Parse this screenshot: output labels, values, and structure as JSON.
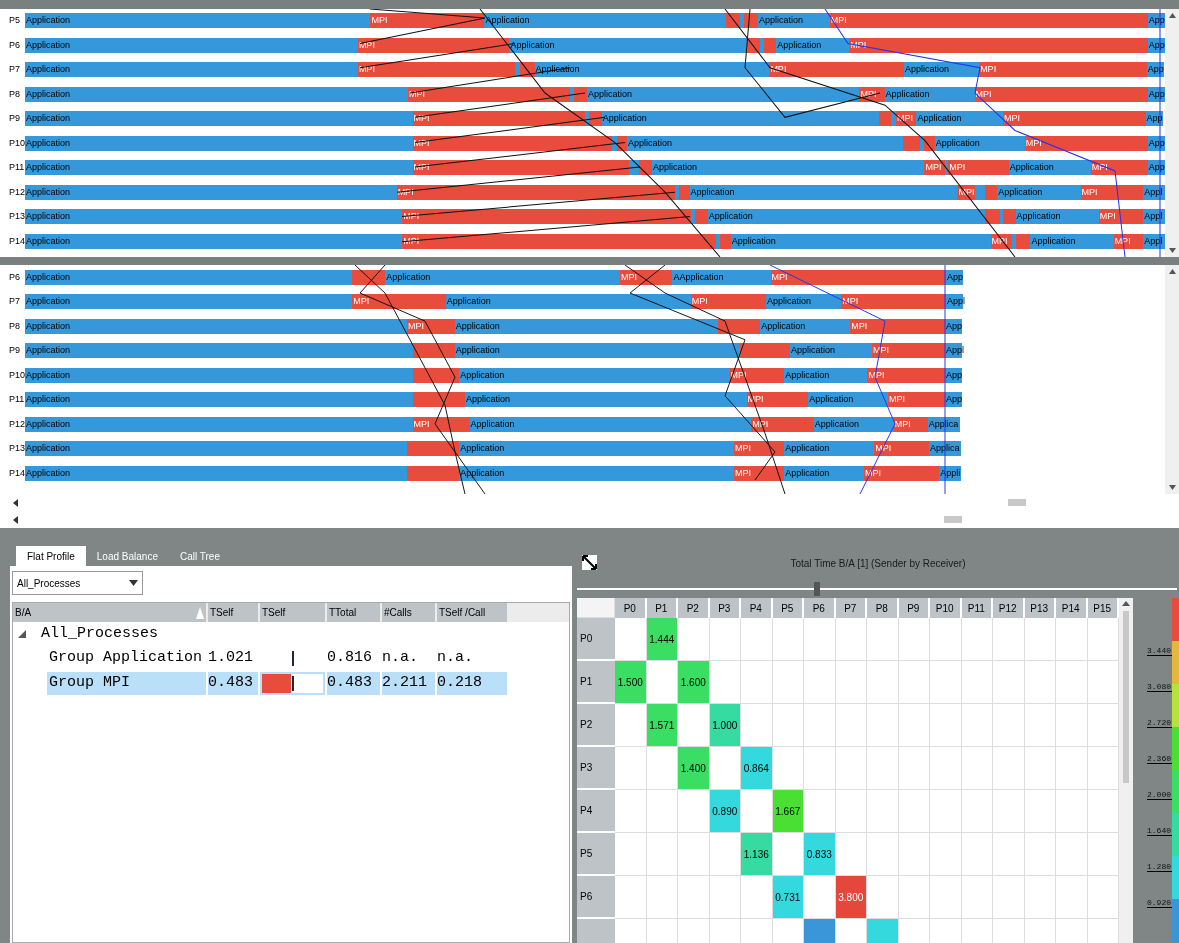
{
  "timeline_top": {
    "rows": [
      {
        "label": "P5",
        "segments": [
          {
            "kind": "app",
            "label": "Application"
          },
          {
            "kind": "mpi",
            "label": "MPI"
          },
          {
            "kind": "app",
            "label": "Application"
          },
          {
            "kind": "mpi"
          },
          {
            "kind": "app"
          },
          {
            "kind": "mpi"
          },
          {
            "kind": "app",
            "label": "Application"
          },
          {
            "kind": "mpi",
            "label": "MPI"
          },
          {
            "kind": "app",
            "label": "App"
          }
        ]
      },
      {
        "label": "P6",
        "segments": [
          {
            "kind": "app",
            "label": "Application"
          },
          {
            "kind": "mpi",
            "label": "MPI"
          },
          {
            "kind": "app",
            "label": "Application"
          },
          {
            "kind": "mpi"
          },
          {
            "kind": "app"
          },
          {
            "kind": "mpi"
          },
          {
            "kind": "app",
            "label": "Application"
          },
          {
            "kind": "mpi",
            "label": "MPI"
          },
          {
            "kind": "app",
            "label": "App"
          }
        ]
      },
      {
        "label": "P7",
        "segments": [
          {
            "kind": "app",
            "label": "Application"
          },
          {
            "kind": "mpi",
            "label": "MPI"
          },
          {
            "kind": "app"
          },
          {
            "kind": "mpi"
          },
          {
            "kind": "app",
            "label": "Application"
          },
          {
            "kind": "mpi",
            "label": "MPI"
          },
          {
            "kind": "app",
            "label": "Application"
          },
          {
            "kind": "mpi",
            "label": "MPI"
          },
          {
            "kind": "app",
            "label": "App"
          }
        ]
      },
      {
        "label": "P8",
        "segments": [
          {
            "kind": "app",
            "label": "Application"
          },
          {
            "kind": "mpi",
            "label": "MPI"
          },
          {
            "kind": "app"
          },
          {
            "kind": "mpi"
          },
          {
            "kind": "app",
            "label": "Application"
          },
          {
            "kind": "mpi",
            "label": "MPI"
          },
          {
            "kind": "app",
            "label": "Application"
          },
          {
            "kind": "mpi",
            "label": "MPI"
          },
          {
            "kind": "app",
            "label": "App"
          }
        ]
      },
      {
        "label": "P9",
        "segments": [
          {
            "kind": "app",
            "label": "Application"
          },
          {
            "kind": "mpi",
            "label": "MPI"
          },
          {
            "kind": "app"
          },
          {
            "kind": "mpi"
          },
          {
            "kind": "app",
            "label": "Application"
          },
          {
            "kind": "mpi"
          },
          {
            "kind": "app"
          },
          {
            "kind": "mpi",
            "label": "MPI"
          },
          {
            "kind": "app",
            "label": "Application"
          },
          {
            "kind": "mpi",
            "label": "MPI"
          },
          {
            "kind": "app",
            "label": "App"
          }
        ]
      },
      {
        "label": "P10",
        "segments": [
          {
            "kind": "app",
            "label": "Application"
          },
          {
            "kind": "mpi",
            "label": "MPI"
          },
          {
            "kind": "app"
          },
          {
            "kind": "mpi"
          },
          {
            "kind": "app",
            "label": "Application"
          },
          {
            "kind": "mpi"
          },
          {
            "kind": "app"
          },
          {
            "kind": "mpi"
          },
          {
            "kind": "app",
            "label": "Application"
          },
          {
            "kind": "mpi",
            "label": "MPI"
          },
          {
            "kind": "app",
            "label": "App"
          }
        ]
      },
      {
        "label": "P11",
        "segments": [
          {
            "kind": "app",
            "label": "Application"
          },
          {
            "kind": "mpi",
            "label": "MPI"
          },
          {
            "kind": "app"
          },
          {
            "kind": "mpi"
          },
          {
            "kind": "app",
            "label": "Application"
          },
          {
            "kind": "mpi",
            "label": "MPI"
          },
          {
            "kind": "app"
          },
          {
            "kind": "mpi",
            "label": "MPI"
          },
          {
            "kind": "app",
            "label": "Application"
          },
          {
            "kind": "mpi",
            "label": "MPI"
          },
          {
            "kind": "app",
            "label": "App"
          }
        ]
      },
      {
        "label": "P12",
        "segments": [
          {
            "kind": "app",
            "label": "Application"
          },
          {
            "kind": "mpi",
            "label": "MPI"
          },
          {
            "kind": "app"
          },
          {
            "kind": "mpi"
          },
          {
            "kind": "app",
            "label": "Application"
          },
          {
            "kind": "mpi",
            "label": "MPI"
          },
          {
            "kind": "app"
          },
          {
            "kind": "mpi"
          },
          {
            "kind": "app",
            "label": "Application"
          },
          {
            "kind": "mpi",
            "label": "MPI"
          },
          {
            "kind": "app",
            "label": "Appl"
          }
        ]
      },
      {
        "label": "P13",
        "segments": [
          {
            "kind": "app",
            "label": "Application"
          },
          {
            "kind": "mpi",
            "label": "MPI"
          },
          {
            "kind": "app"
          },
          {
            "kind": "mpi"
          },
          {
            "kind": "app",
            "label": "Application"
          },
          {
            "kind": "mpi"
          },
          {
            "kind": "app"
          },
          {
            "kind": "mpi"
          },
          {
            "kind": "app",
            "label": "Application"
          },
          {
            "kind": "mpi",
            "label": "MPI"
          },
          {
            "kind": "app",
            "label": "Appl"
          }
        ]
      },
      {
        "label": "P14",
        "segments": [
          {
            "kind": "app",
            "label": "Application"
          },
          {
            "kind": "mpi",
            "label": "MPI"
          },
          {
            "kind": "app"
          },
          {
            "kind": "mpi"
          },
          {
            "kind": "app",
            "label": "Application"
          },
          {
            "kind": "mpi",
            "label": "MPI"
          },
          {
            "kind": "app"
          },
          {
            "kind": "mpi"
          },
          {
            "kind": "app",
            "label": "Application"
          },
          {
            "kind": "mpi",
            "label": "MPI"
          },
          {
            "kind": "app",
            "label": "Appl"
          }
        ]
      }
    ]
  },
  "timeline_bottom": {
    "rows": [
      {
        "label": "P6",
        "segments": [
          {
            "kind": "app",
            "label": "Application"
          },
          {
            "kind": "mpi"
          },
          {
            "kind": "app",
            "label": "Application"
          },
          {
            "kind": "mpi",
            "label": "MPI"
          },
          {
            "kind": "app",
            "label": "AApplication"
          },
          {
            "kind": "mpi",
            "label": "MPI"
          },
          {
            "kind": "app",
            "label": "App"
          }
        ]
      },
      {
        "label": "P7",
        "segments": [
          {
            "kind": "app",
            "label": "Application"
          },
          {
            "kind": "mpi",
            "label": "MPI"
          },
          {
            "kind": "app",
            "label": "Application"
          },
          {
            "kind": "mpi",
            "label": "MPI"
          },
          {
            "kind": "app",
            "label": "Application"
          },
          {
            "kind": "mpi",
            "label": "MPI"
          },
          {
            "kind": "app",
            "label": "Appl"
          }
        ]
      },
      {
        "label": "P8",
        "segments": [
          {
            "kind": "app",
            "label": "Application"
          },
          {
            "kind": "mpi",
            "label": "MPI"
          },
          {
            "kind": "app",
            "label": "Application"
          },
          {
            "kind": "mpi"
          },
          {
            "kind": "app",
            "label": "Application"
          },
          {
            "kind": "mpi",
            "label": "MPI"
          },
          {
            "kind": "app",
            "label": "App"
          }
        ]
      },
      {
        "label": "P9",
        "segments": [
          {
            "kind": "app",
            "label": "Application"
          },
          {
            "kind": "mpi"
          },
          {
            "kind": "app",
            "label": "Application"
          },
          {
            "kind": "mpi"
          },
          {
            "kind": "app",
            "label": "Application"
          },
          {
            "kind": "mpi",
            "label": "MPI"
          },
          {
            "kind": "app",
            "label": "Appl"
          }
        ]
      },
      {
        "label": "P10",
        "segments": [
          {
            "kind": "app",
            "label": "Application"
          },
          {
            "kind": "mpi"
          },
          {
            "kind": "app",
            "label": "Application"
          },
          {
            "kind": "mpi",
            "label": "MPI"
          },
          {
            "kind": "app",
            "label": "Application"
          },
          {
            "kind": "mpi",
            "label": "MPI"
          },
          {
            "kind": "app",
            "label": "App"
          }
        ]
      },
      {
        "label": "P11",
        "segments": [
          {
            "kind": "app",
            "label": "Application"
          },
          {
            "kind": "mpi"
          },
          {
            "kind": "app",
            "label": "Application"
          },
          {
            "kind": "mpi",
            "label": "MPI"
          },
          {
            "kind": "app",
            "label": "Application"
          },
          {
            "kind": "mpi",
            "label": "MPI"
          },
          {
            "kind": "app",
            "label": "App"
          }
        ]
      },
      {
        "label": "P12",
        "segments": [
          {
            "kind": "app",
            "label": "Application"
          },
          {
            "kind": "mpi",
            "label": "MPI"
          },
          {
            "kind": "app",
            "label": "Application"
          },
          {
            "kind": "mpi",
            "label": "MPI"
          },
          {
            "kind": "app",
            "label": "Application"
          },
          {
            "kind": "mpi",
            "label": "MPI"
          },
          {
            "kind": "app",
            "label": "Applica"
          }
        ]
      },
      {
        "label": "P13",
        "segments": [
          {
            "kind": "app",
            "label": "Application"
          },
          {
            "kind": "mpi"
          },
          {
            "kind": "app",
            "label": "Application"
          },
          {
            "kind": "mpi",
            "label": "MPI"
          },
          {
            "kind": "app",
            "label": "Application"
          },
          {
            "kind": "mpi",
            "label": "MPI"
          },
          {
            "kind": "app",
            "label": "Applica"
          }
        ]
      },
      {
        "label": "P14",
        "segments": [
          {
            "kind": "app",
            "label": "Application"
          },
          {
            "kind": "mpi"
          },
          {
            "kind": "app",
            "label": "Application"
          },
          {
            "kind": "mpi",
            "label": "MPI"
          },
          {
            "kind": "app",
            "label": "Application"
          },
          {
            "kind": "mpi",
            "label": "MPI"
          },
          {
            "kind": "app",
            "label": "Appli"
          }
        ]
      }
    ]
  },
  "tabs": [
    {
      "label": "Flat Profile",
      "selected": true
    },
    {
      "label": "Load Balance",
      "selected": false
    },
    {
      "label": "Call Tree",
      "selected": false
    }
  ],
  "profile": {
    "filter": "All_Processes",
    "columns": [
      "B/A",
      "TSelf",
      "TSelf",
      "TTotal",
      "#Calls",
      "TSelf /Call"
    ],
    "tree": [
      {
        "label": "All_Processes",
        "expanded": true,
        "children": [
          {
            "label": "Group Application",
            "selected": false,
            "tself": "1.021",
            "ttotal": "0.816",
            "calls": "n.a.",
            "tself_per_call": "n.a."
          },
          {
            "label": "Group MPI",
            "selected": true,
            "tself": "0.483",
            "bar": {
              "level": 0.48
            },
            "ttotal": "0.483",
            "calls": "2.211",
            "tself_per_call": "0.218"
          }
        ]
      }
    ]
  },
  "matrix": {
    "title": "Total Time B/A [1] (Sender by Receiver)",
    "slider": {
      "level": 0.4
    },
    "columns": [
      "P0",
      "P1",
      "P2",
      "P3",
      "P4",
      "P5",
      "P6",
      "P7",
      "P8",
      "P9",
      "P10",
      "P11",
      "P12",
      "P13",
      "P14",
      "P15"
    ],
    "rows": [
      {
        "label": "P0",
        "cells": [
          null,
          {
            "value": "1.444",
            "color": "#3ade62"
          }
        ]
      },
      {
        "label": "P1",
        "cells": [
          {
            "value": "1.500",
            "color": "#3ade62"
          },
          null,
          {
            "value": "1.600",
            "color": "#3ade62"
          }
        ]
      },
      {
        "label": "P2",
        "cells": [
          null,
          {
            "value": "1.571",
            "color": "#3ade62"
          },
          null,
          {
            "value": "1.000",
            "color": "#35dba0"
          }
        ]
      },
      {
        "label": "P3",
        "cells": [
          null,
          null,
          {
            "value": "1.400",
            "color": "#3ade62"
          },
          null,
          {
            "value": "0.864",
            "color": "#33d9dc"
          }
        ]
      },
      {
        "label": "P4",
        "cells": [
          null,
          null,
          null,
          {
            "value": "0.890",
            "color": "#33d9dc"
          },
          null,
          {
            "value": "1.667",
            "color": "#4ae033"
          }
        ]
      },
      {
        "label": "P5",
        "cells": [
          null,
          null,
          null,
          null,
          {
            "value": "1.136",
            "color": "#35dba0"
          },
          null,
          {
            "value": "0.833",
            "color": "#33d9dc"
          }
        ]
      },
      {
        "label": "P6",
        "cells": [
          null,
          null,
          null,
          null,
          null,
          {
            "value": "0.731",
            "color": "#33d9dc"
          },
          null,
          {
            "value": "3.800",
            "color": "#e5473c"
          }
        ]
      },
      {
        "cells": [
          null,
          null,
          null,
          null,
          null,
          null,
          {
            "color": "#3a96d9"
          },
          null,
          {
            "color": "#33d9dc"
          }
        ]
      }
    ],
    "legend": [
      "3.440",
      "3.080",
      "2.720",
      "2.360",
      "2.000",
      "1.640",
      "1.280",
      "0.920"
    ]
  }
}
